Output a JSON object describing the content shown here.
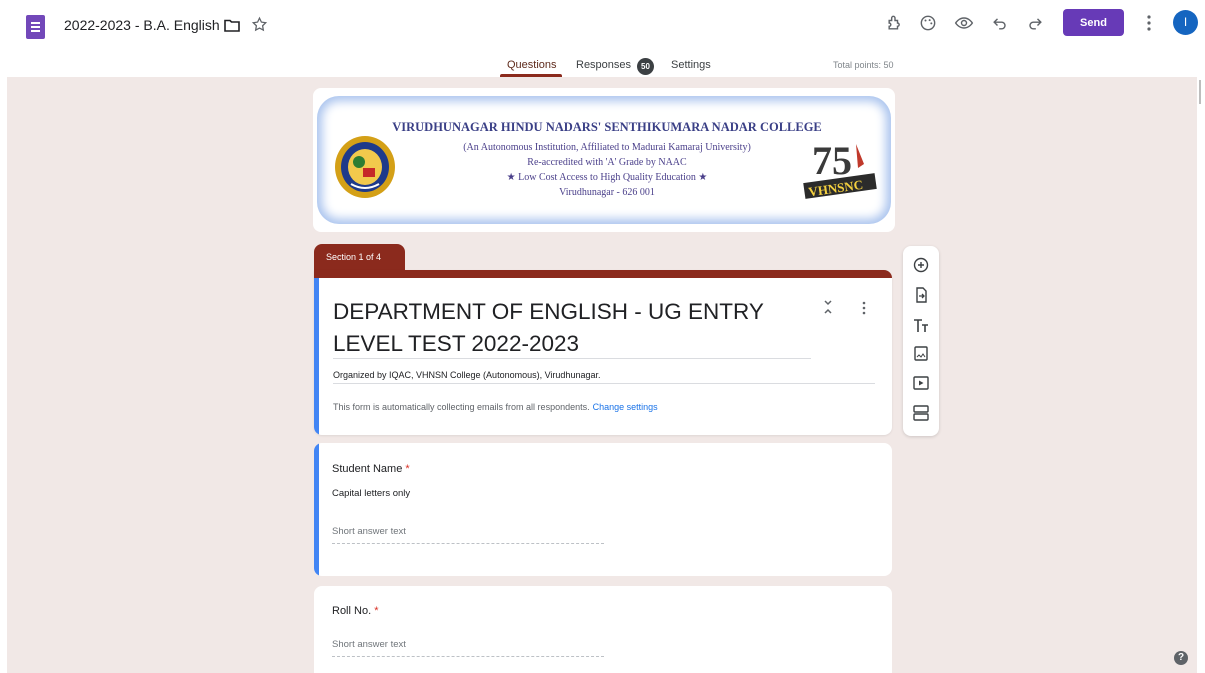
{
  "header": {
    "doc_title": "2022-2023 - B.A. English",
    "send_label": "Send",
    "avatar_initial": "I",
    "accent_color": "#673ab7"
  },
  "tabs": {
    "questions": "Questions",
    "responses": "Responses",
    "responses_count": "50",
    "settings": "Settings",
    "total_points": "Total points: 50"
  },
  "banner": {
    "college_name": "VIRUDHUNAGAR HINDU NADARS' SENTHIKUMARA NADAR COLLEGE",
    "line2": "(An Autonomous Institution, Affiliated to Madurai Kamaraj University)",
    "line3": "Re-accredited with 'A' Grade by NAAC",
    "line4": "★ Low Cost Access to High Quality Education ★",
    "line5": "Virudhunagar - 626 001",
    "logo_right_text": "VHNSNC",
    "logo_right_number": "75"
  },
  "section": {
    "tag": "Section 1 of 4",
    "title": "DEPARTMENT OF ENGLISH - UG ENTRY LEVEL TEST 2022-2023",
    "description": "Organized by IQAC, VHNSN College (Autonomous), Virudhunagar.",
    "email_note": "This form is automatically collecting emails from all respondents.",
    "change_settings": "Change settings",
    "theme_color": "#8b2a1d"
  },
  "questions": [
    {
      "label": "Student Name",
      "required_mark": "*",
      "description": "Capital letters only",
      "placeholder": "Short answer text"
    },
    {
      "label": "Roll No.",
      "required_mark": "*",
      "placeholder": "Short answer text"
    }
  ],
  "toolbar_icons": [
    "add-question-icon",
    "import-questions-icon",
    "add-title-icon",
    "add-image-icon",
    "add-video-icon",
    "add-section-icon"
  ],
  "help": "?"
}
